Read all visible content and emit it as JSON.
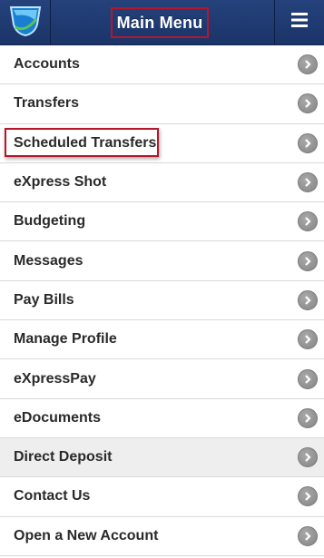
{
  "header": {
    "title": "Main Menu",
    "logo_icon": "logo-icon",
    "menu_icon": "hamburger-icon",
    "colors": {
      "bar": "#1f3a72",
      "highlight_border": "#b7152a"
    }
  },
  "menu": {
    "chevron_icon": "chevron-right-icon",
    "items": [
      {
        "label": "Accounts"
      },
      {
        "label": "Transfers"
      },
      {
        "label": "Scheduled Transfers"
      },
      {
        "label": "eXpress Shot"
      },
      {
        "label": "Budgeting"
      },
      {
        "label": "Messages"
      },
      {
        "label": "Pay Bills"
      },
      {
        "label": "Manage Profile"
      },
      {
        "label": "eXpressPay"
      },
      {
        "label": "eDocuments"
      },
      {
        "label": "Direct Deposit"
      },
      {
        "label": "Contact Us"
      },
      {
        "label": "Open a New Account"
      }
    ]
  }
}
